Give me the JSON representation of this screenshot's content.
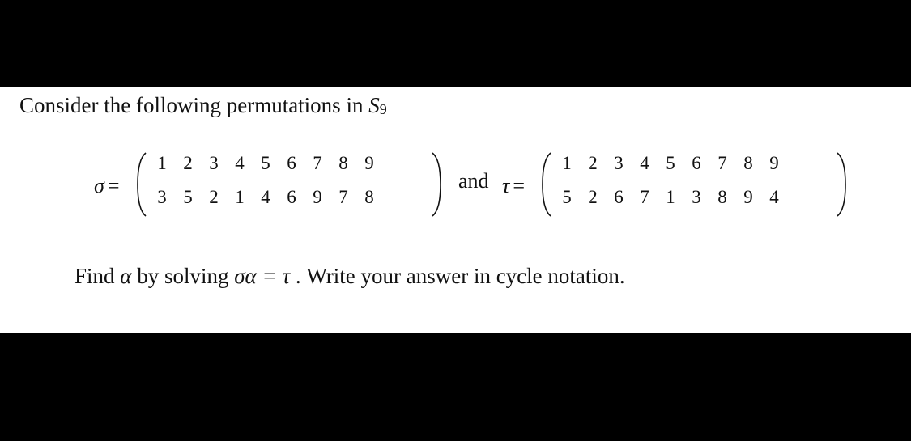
{
  "intro": {
    "text": "Consider the following permutations in ",
    "group_symbol": "S",
    "group_index": "9"
  },
  "sigma": {
    "symbol": "σ",
    "equals": "=",
    "top_row": [
      "1",
      "2",
      "3",
      "4",
      "5",
      "6",
      "7",
      "8",
      "9"
    ],
    "bottom_row": [
      "3",
      "5",
      "2",
      "1",
      "4",
      "6",
      "9",
      "7",
      "8"
    ]
  },
  "connector": "and",
  "tau": {
    "symbol": "τ",
    "equals": "=",
    "top_row": [
      "1",
      "2",
      "3",
      "4",
      "5",
      "6",
      "7",
      "8",
      "9"
    ],
    "bottom_row": [
      "5",
      "2",
      "6",
      "7",
      "1",
      "3",
      "8",
      "9",
      "4"
    ]
  },
  "question": {
    "prefix": "Find ",
    "alpha": "α",
    "middle": " by solving ",
    "equation": "σα = τ",
    "suffix": " . Write your answer in cycle notation."
  }
}
